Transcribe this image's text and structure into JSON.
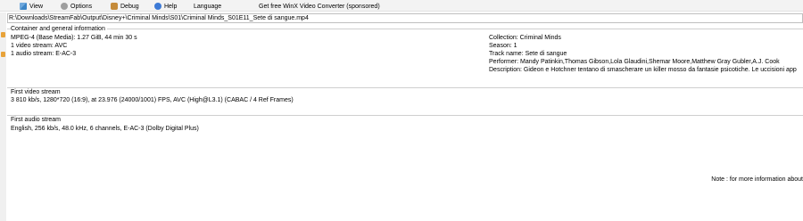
{
  "menu": {
    "view": "View",
    "options": "Options",
    "debug": "Debug",
    "help": "Help",
    "language": "Language",
    "promo": "Get free WinX Video Converter (sponsored)"
  },
  "file_path": "R:\\Downloads\\StreamFab\\Output\\Disney+\\Criminal Minds\\S01\\Criminal Minds_S01E11_Sete di sangue.mp4",
  "general": {
    "title": "Container and general information",
    "left": [
      "MPEG-4 (Base Media): 1.27 GiB, 44 min 30 s",
      "1 video stream: AVC",
      "1 audio stream: E-AC-3"
    ],
    "right": [
      "Collection: Criminal Minds",
      "Season: 1",
      "Track name: Sete di sangue",
      "Performer: Mandy Patinkin,Thomas Gibson,Lola Glaudini,Shemar Moore,Matthew Gray Gubler,A.J. Cook",
      "Description: Gideon e Hotchner tentano di smascherare un killer mosso da fantasie psicotiche. Le uccisioni app"
    ]
  },
  "video": {
    "title": "First video stream",
    "line": "3 810 kb/s, 1280*720 (16:9), at 23.976 (24000/1001) FPS, AVC (High@L3.1) (CABAC / 4 Ref Frames)"
  },
  "audio": {
    "title": "First audio stream",
    "line": "English, 256 kb/s, 48.0 kHz, 6 channels, E-AC-3 (Dolby Digital Plus)"
  },
  "note": "Note : for more information about"
}
